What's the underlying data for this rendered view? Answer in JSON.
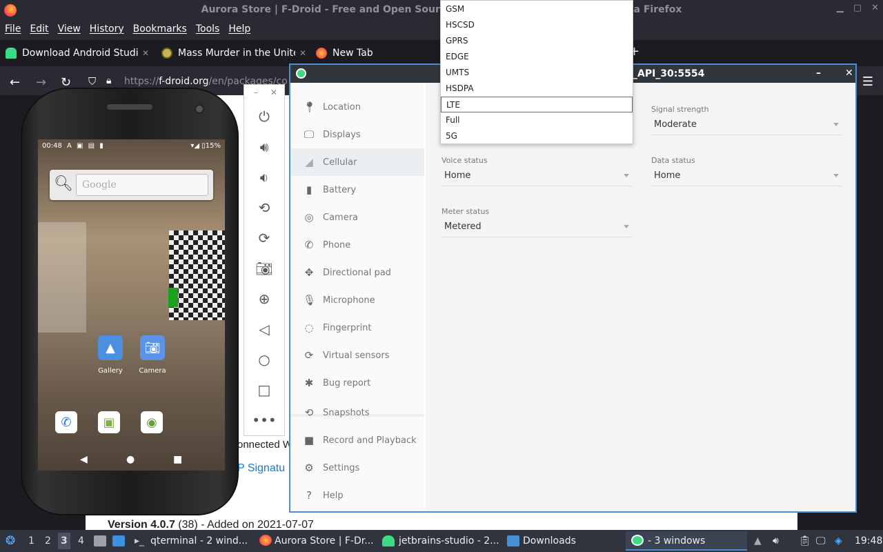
{
  "firefox": {
    "title": "Aurora Store | F-Droid - Free and Open Source Android App Repository — Mozilla Firefox",
    "menu": [
      "File",
      "Edit",
      "View",
      "History",
      "Bookmarks",
      "Tools",
      "Help"
    ],
    "tabs": [
      {
        "label": "Download Android Studio"
      },
      {
        "label": "Mass Murder in the Unite"
      },
      {
        "label": "New Tab"
      }
    ],
    "url_prefix": "https://",
    "url_host": "f-droid.org",
    "url_path": "/en/packages/co"
  },
  "page_bg": {
    "connected": "onnected W",
    "signature": "P Signatu",
    "version": "Version 4.0.7",
    "version_build": " (38) - Added on 2021-07-07"
  },
  "phone": {
    "time": "00:48",
    "battery": "15%",
    "status_icons": "A ▣ ▤ ▮",
    "search_placeholder": "Google",
    "apps": [
      {
        "label": "Gallery"
      },
      {
        "label": "Camera"
      }
    ]
  },
  "extended_controls": {
    "title": "_API_30:5554",
    "sidebar": [
      {
        "label": "Location",
        "icon": "location-pin-icon"
      },
      {
        "label": "Displays",
        "icon": "monitor-icon"
      },
      {
        "label": "Cellular",
        "icon": "signal-icon"
      },
      {
        "label": "Battery",
        "icon": "battery-icon"
      },
      {
        "label": "Camera",
        "icon": "camera-aperture-icon"
      },
      {
        "label": "Phone",
        "icon": "phone-icon"
      },
      {
        "label": "Directional pad",
        "icon": "dpad-icon"
      },
      {
        "label": "Microphone",
        "icon": "microphone-icon"
      },
      {
        "label": "Fingerprint",
        "icon": "fingerprint-icon"
      },
      {
        "label": "Virtual sensors",
        "icon": "rotate-icon"
      },
      {
        "label": "Bug report",
        "icon": "bug-icon"
      },
      {
        "label": "Snapshots",
        "icon": "history-icon"
      },
      {
        "label": "Record and Playback",
        "icon": "video-camera-icon"
      },
      {
        "label": "Settings",
        "icon": "gear-icon"
      },
      {
        "label": "Help",
        "icon": "help-icon"
      }
    ],
    "active_item": "Cellular",
    "fields": {
      "signal_strength_label": "Signal strength",
      "signal_strength_value": "Moderate",
      "voice_status_label": "Voice status",
      "voice_status_value": "Home",
      "data_status_label": "Data status",
      "data_status_value": "Home",
      "meter_status_label": "Meter status",
      "meter_status_value": "Metered"
    },
    "network_type_options": [
      "GSM",
      "HSCSD",
      "GPRS",
      "EDGE",
      "UMTS",
      "HSDPA",
      "LTE",
      "Full",
      "5G"
    ],
    "network_type_selected": "LTE"
  },
  "taskbar": {
    "workspaces": [
      "1",
      "2",
      "3",
      "4"
    ],
    "current_workspace": "3",
    "tasks": [
      {
        "label": "qterminal - 2 wind..."
      },
      {
        "label": "Aurora Store | F-Dr..."
      },
      {
        "label": "jetbrains-studio - 2..."
      },
      {
        "label": "Downloads"
      },
      {
        "label": "- 3 windows"
      }
    ],
    "clock": "19:48"
  }
}
